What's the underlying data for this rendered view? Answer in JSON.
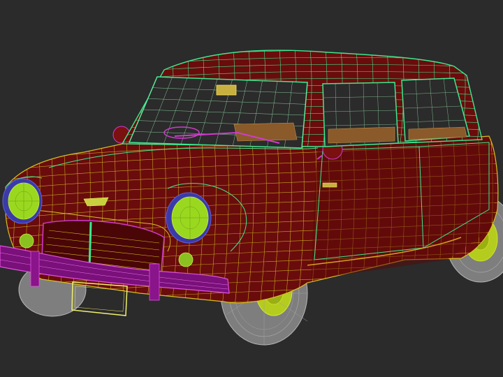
{
  "scene": {
    "subject": "wireframe-car-model",
    "colors": {
      "background": "#2b2b2b",
      "body_fill": "#6a0c0c",
      "body_fill_dark": "#4a0606",
      "body_wire": "#d8c020",
      "cabin_wire": "#3ee890",
      "chrome_wire": "#d23ad2",
      "tire_fill": "#8a8a8a",
      "tire_wire": "#b8b8b8",
      "hub_fill": "#b4cc1e",
      "headlight_fill": "#9ad820",
      "headlight_ring": "#4040c0",
      "plate_wire": "#f0f070",
      "interior": "#b0823a",
      "glass_wire": "#9ef0b8"
    }
  }
}
